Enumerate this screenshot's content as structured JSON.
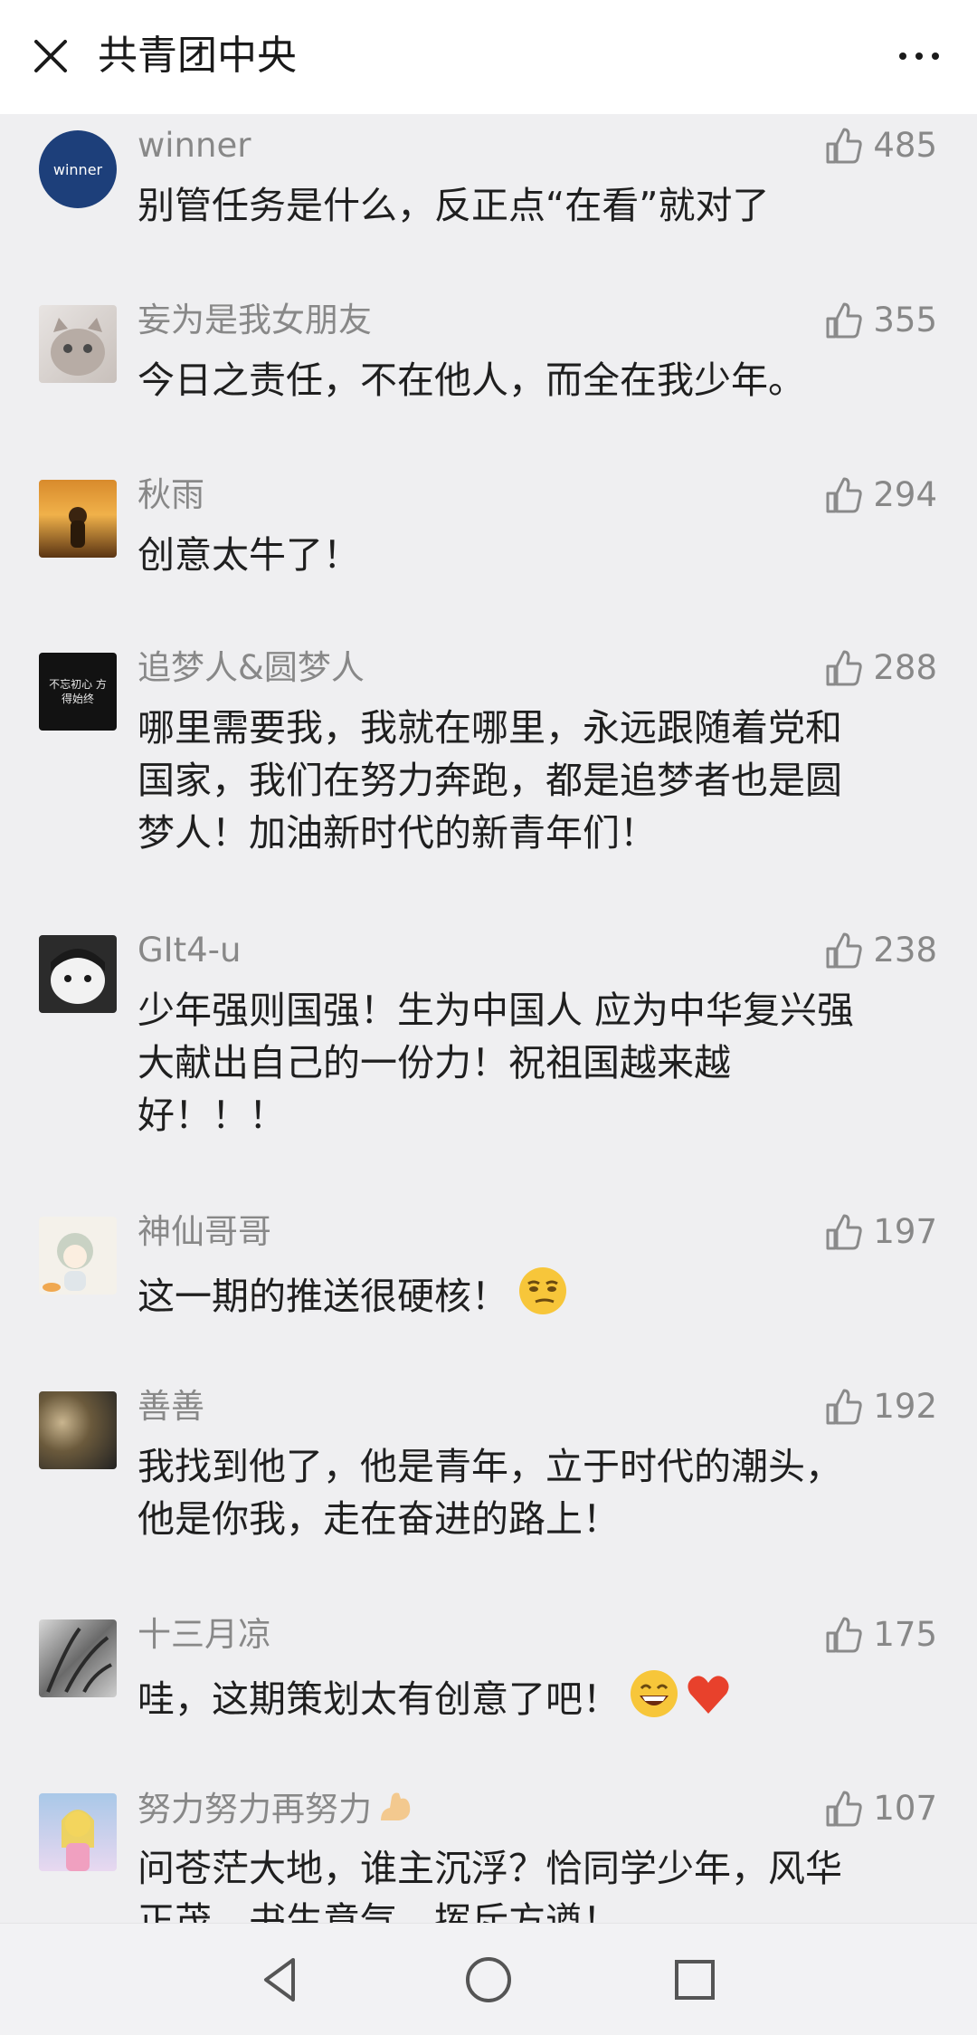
{
  "header": {
    "title": "共青团中央",
    "close_icon": "close-icon",
    "more_icon": "more-icon"
  },
  "comments": [
    {
      "nickname": "winner",
      "likes": "485",
      "text": "别管任务是什么，反正点“在看”就对了",
      "avatar_label": "winner"
    },
    {
      "nickname": "妄为是我女朋友",
      "likes": "355",
      "text": "今日之责任，不在他人，而全在我少年。"
    },
    {
      "nickname": "秋雨",
      "likes": "294",
      "text": "创意太牛了！"
    },
    {
      "nickname": "追梦人&圆梦人",
      "likes": "288",
      "text": "哪里需要我，我就在哪里，永远跟随着党和\n国家，我们在努力奔跑，都是追梦者也是圆\n梦人！加油新时代的新青年们！",
      "avatar_label": "不忘初心 方得始终"
    },
    {
      "nickname": "GIt4-u",
      "likes": "238",
      "text": "少年强则国强！生为中国人 应为中华复兴强\n大献出自己的一份力！祝祖国越来越\n好！！！"
    },
    {
      "nickname": "神仙哥哥",
      "likes": "197",
      "text": "这一期的推送很硬核！",
      "emojis": [
        "smirk-emoji"
      ]
    },
    {
      "nickname": "善善",
      "likes": "192",
      "text": "我找到他了，他是青年，立于时代的潮头，\n他是你我，走在奋进的路上！"
    },
    {
      "nickname": "十三月凉",
      "likes": "175",
      "text": "哇，这期策划太有创意了吧！",
      "emojis": [
        "grin-emoji",
        "heart-emoji"
      ]
    },
    {
      "nickname": "努力努力再努力",
      "likes": "107",
      "text": "问苍茫大地，谁主沉浮？恰同学少年，风华\n正茂，书生意气，挥斥方遒！",
      "nickname_emoji": "flexed-arm-emoji"
    }
  ],
  "navbar": {
    "back_icon": "back-triangle-icon",
    "home_icon": "home-circle-icon",
    "recents_icon": "recents-square-icon"
  },
  "colors": {
    "background": "#efeff1",
    "header": "#ffffff",
    "nickname": "#888888",
    "text": "#1f1f1f"
  }
}
